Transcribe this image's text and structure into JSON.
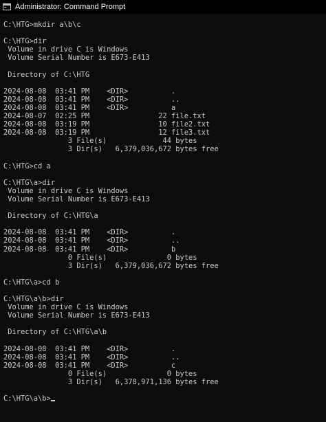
{
  "window": {
    "title": "Administrator: Command Prompt",
    "icon": "command-prompt-icon"
  },
  "colors": {
    "background": "#0c0c0c",
    "text": "#cccccc",
    "titlebar": "#000000",
    "title_text": "#ffffff"
  },
  "console": {
    "lines": [
      "C:\\HTG>mkdir a\\b\\c",
      "",
      "C:\\HTG>dir",
      " Volume in drive C is Windows",
      " Volume Serial Number is E673-E413",
      "",
      " Directory of C:\\HTG",
      "",
      "2024-08-08  03:41 PM    <DIR>          .",
      "2024-08-08  03:41 PM    <DIR>          ..",
      "2024-08-08  03:41 PM    <DIR>          a",
      "2024-08-07  02:25 PM                22 file.txt",
      "2024-08-08  03:19 PM                10 file2.txt",
      "2024-08-08  03:19 PM                12 file3.txt",
      "               3 File(s)             44 bytes",
      "               3 Dir(s)   6,379,036,672 bytes free",
      "",
      "C:\\HTG>cd a",
      "",
      "C:\\HTG\\a>dir",
      " Volume in drive C is Windows",
      " Volume Serial Number is E673-E413",
      "",
      " Directory of C:\\HTG\\a",
      "",
      "2024-08-08  03:41 PM    <DIR>          .",
      "2024-08-08  03:41 PM    <DIR>          ..",
      "2024-08-08  03:41 PM    <DIR>          b",
      "               0 File(s)              0 bytes",
      "               3 Dir(s)   6,379,036,672 bytes free",
      "",
      "C:\\HTG\\a>cd b",
      "",
      "C:\\HTG\\a\\b>dir",
      " Volume in drive C is Windows",
      " Volume Serial Number is E673-E413",
      "",
      " Directory of C:\\HTG\\a\\b",
      "",
      "2024-08-08  03:41 PM    <DIR>          .",
      "2024-08-08  03:41 PM    <DIR>          ..",
      "2024-08-08  03:41 PM    <DIR>          c",
      "               0 File(s)              0 bytes",
      "               3 Dir(s)   6,378,971,136 bytes free",
      "",
      "C:\\HTG\\a\\b>"
    ]
  }
}
